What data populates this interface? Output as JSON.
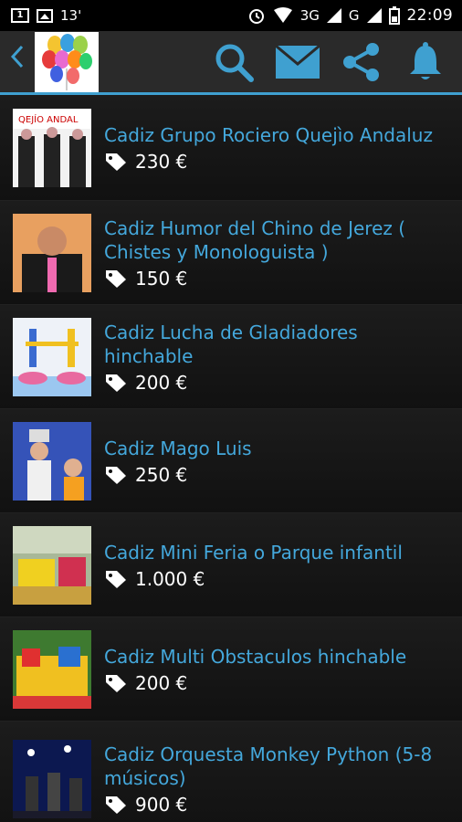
{
  "status": {
    "sim": "1",
    "temp": "13'",
    "network1": "3G",
    "network2": "G",
    "time": "22:09"
  },
  "appbar": {
    "back_icon": "chevron-left-icon",
    "actions": [
      "search-icon",
      "mail-icon",
      "share-icon",
      "bell-icon"
    ],
    "accent": "#3fa0d0"
  },
  "items": [
    {
      "title": "Cadiz Grupo Rociero Quejìo Andaluz",
      "price": "230 €"
    },
    {
      "title": "Cadiz Humor del Chino de Jerez ( Chistes y Monologuista )",
      "price": "150 €"
    },
    {
      "title": "Cadiz Lucha de Gladiadores hinchable",
      "price": "200 €"
    },
    {
      "title": "Cadiz Mago Luis",
      "price": "250 €"
    },
    {
      "title": "Cadiz Mini Feria o Parque infantil",
      "price": "1.000 €"
    },
    {
      "title": "Cadiz Multi Obstaculos hinchable",
      "price": "200 €"
    },
    {
      "title": "Cadiz Orquesta Monkey Python (5-8 músicos)",
      "price": "900 €"
    }
  ]
}
